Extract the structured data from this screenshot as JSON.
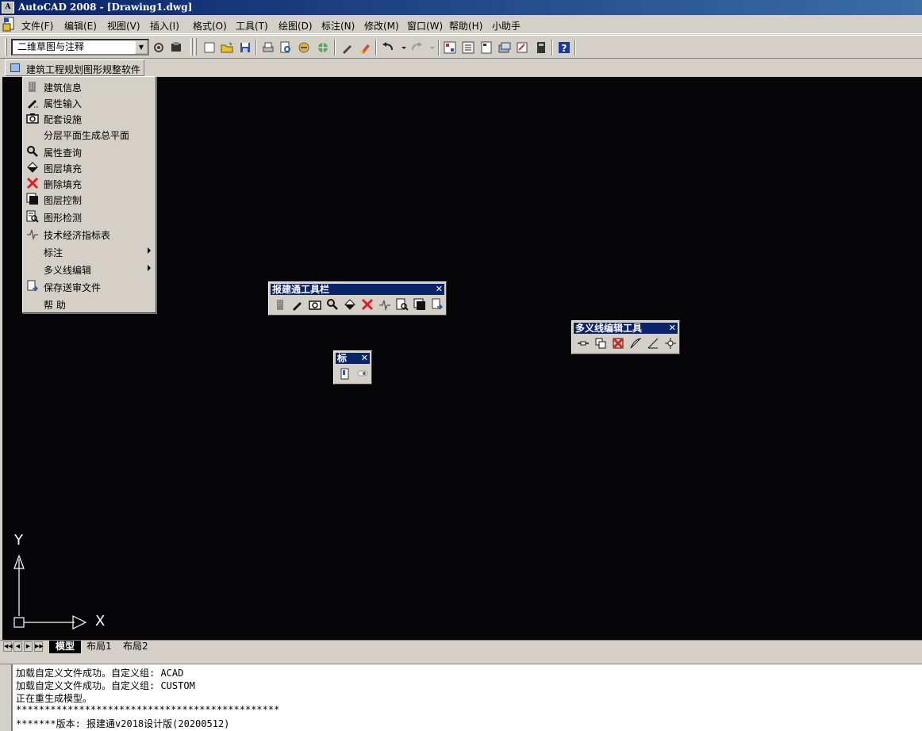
{
  "window": {
    "title": "AutoCAD 2008 - [Drawing1.dwg]",
    "icon": "autocad-app-icon"
  },
  "menubar": {
    "items": [
      "文件(F)",
      "编辑(E)",
      "视图(V)",
      "插入(I)",
      "格式(O)",
      "工具(T)",
      "绘图(D)",
      "标注(N)",
      "修改(M)",
      "窗口(W)",
      "帮助(H)",
      "小助手"
    ]
  },
  "toolbar": {
    "workspace_combo": "二维草图与注释",
    "icons": [
      "new-icon",
      "open-icon",
      "save-icon",
      "print-icon",
      "print-preview-icon",
      "publish-icon",
      "3d-dwf-icon",
      "match-properties-icon",
      "brush-icon",
      "undo-icon",
      "redo-icon",
      "properties-icon",
      "design-center-icon",
      "tool-palettes-icon",
      "sheet-set-icon",
      "markup-icon",
      "calculator-icon",
      "help-icon"
    ]
  },
  "custom_menu": {
    "tab_label": "建筑工程规划图形规整软件",
    "items": [
      {
        "label": "建筑信息",
        "icon": "building-icon",
        "submenu": false
      },
      {
        "label": "属性输入",
        "icon": "pencil-icon",
        "submenu": false
      },
      {
        "label": "配套设施",
        "icon": "camera-icon",
        "submenu": false
      },
      {
        "label": "分层平面生成总平面",
        "icon": "",
        "submenu": false
      },
      {
        "label": "属性查询",
        "icon": "magnifier-icon",
        "submenu": false
      },
      {
        "label": "图层填充",
        "icon": "fill-icon",
        "submenu": false
      },
      {
        "label": "删除填充",
        "icon": "delete-fill-icon",
        "submenu": false
      },
      {
        "label": "图层控制",
        "icon": "layer-icon",
        "submenu": false
      },
      {
        "label": "图形检测",
        "icon": "inspect-icon",
        "submenu": false
      },
      {
        "label": "技术经济指标表",
        "icon": "pulse-icon",
        "submenu": false
      },
      {
        "label": "标注",
        "icon": "",
        "submenu": true
      },
      {
        "label": "多义线编辑",
        "icon": "",
        "submenu": true
      },
      {
        "label": "保存送审文件",
        "icon": "export-icon",
        "submenu": false
      },
      {
        "label": "帮 助",
        "icon": "",
        "submenu": false
      }
    ]
  },
  "floating_toolbars": {
    "baojiantong": {
      "title": "报建通工具栏",
      "close": "✕"
    },
    "biao": {
      "title": "标",
      "close": "✕"
    },
    "polyline": {
      "title": "多义线编辑工具",
      "close": "✕"
    }
  },
  "ucs": {
    "x_label": "X",
    "y_label": "Y"
  },
  "layout_tabs": [
    "模型",
    "布局1",
    "布局2"
  ],
  "command_lines": [
    "加载自定义文件成功。自定义组: ACAD",
    "加载自定义文件成功。自定义组: CUSTOM",
    "正在重生成模型。",
    "**********************************************",
    "*******版本: 报建通v2018设计版(20200512)"
  ]
}
